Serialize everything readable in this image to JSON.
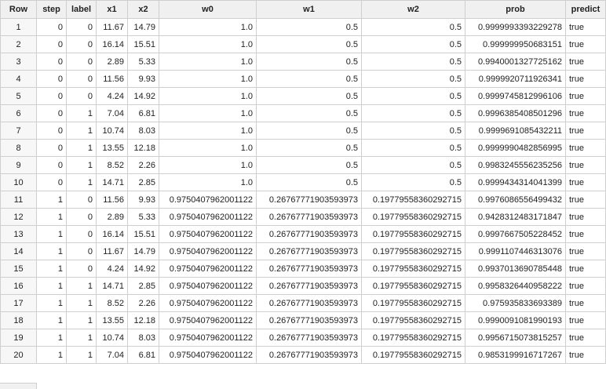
{
  "table": {
    "columns": [
      "Row",
      "step",
      "label",
      "x1",
      "x2",
      "w0",
      "w1",
      "w2",
      "prob",
      "predict"
    ],
    "rows": [
      [
        "1",
        "0",
        "0",
        "11.67",
        "14.79",
        "1.0",
        "0.5",
        "0.5",
        "0.9999993393229278",
        "true"
      ],
      [
        "2",
        "0",
        "0",
        "16.14",
        "15.51",
        "1.0",
        "0.5",
        "0.5",
        "0.999999950683151",
        "true"
      ],
      [
        "3",
        "0",
        "0",
        "2.89",
        "5.33",
        "1.0",
        "0.5",
        "0.5",
        "0.9940001327725162",
        "true"
      ],
      [
        "4",
        "0",
        "0",
        "11.56",
        "9.93",
        "1.0",
        "0.5",
        "0.5",
        "0.9999920711926341",
        "true"
      ],
      [
        "5",
        "0",
        "0",
        "4.24",
        "14.92",
        "1.0",
        "0.5",
        "0.5",
        "0.9999745812996106",
        "true"
      ],
      [
        "6",
        "0",
        "1",
        "7.04",
        "6.81",
        "1.0",
        "0.5",
        "0.5",
        "0.9996385408501296",
        "true"
      ],
      [
        "7",
        "0",
        "1",
        "10.74",
        "8.03",
        "1.0",
        "0.5",
        "0.5",
        "0.9999691085432211",
        "true"
      ],
      [
        "8",
        "0",
        "1",
        "13.55",
        "12.18",
        "1.0",
        "0.5",
        "0.5",
        "0.9999990482856995",
        "true"
      ],
      [
        "9",
        "0",
        "1",
        "8.52",
        "2.26",
        "1.0",
        "0.5",
        "0.5",
        "0.9983245556235256",
        "true"
      ],
      [
        "10",
        "0",
        "1",
        "14.71",
        "2.85",
        "1.0",
        "0.5",
        "0.5",
        "0.9999434314041399",
        "true"
      ],
      [
        "11",
        "1",
        "0",
        "11.56",
        "9.93",
        "0.9750407962001122",
        "0.26767771903593973",
        "0.19779558360292715",
        "0.9976086556499432",
        "true"
      ],
      [
        "12",
        "1",
        "0",
        "2.89",
        "5.33",
        "0.9750407962001122",
        "0.26767771903593973",
        "0.19779558360292715",
        "0.9428312483171847",
        "true"
      ],
      [
        "13",
        "1",
        "0",
        "16.14",
        "15.51",
        "0.9750407962001122",
        "0.26767771903593973",
        "0.19779558360292715",
        "0.9997667505228452",
        "true"
      ],
      [
        "14",
        "1",
        "0",
        "11.67",
        "14.79",
        "0.9750407962001122",
        "0.26767771903593973",
        "0.19779558360292715",
        "0.9991107446313076",
        "true"
      ],
      [
        "15",
        "1",
        "0",
        "4.24",
        "14.92",
        "0.9750407962001122",
        "0.26767771903593973",
        "0.19779558360292715",
        "0.9937013690785448",
        "true"
      ],
      [
        "16",
        "1",
        "1",
        "14.71",
        "2.85",
        "0.9750407962001122",
        "0.26767771903593973",
        "0.19779558360292715",
        "0.9958326440958222",
        "true"
      ],
      [
        "17",
        "1",
        "1",
        "8.52",
        "2.26",
        "0.9750407962001122",
        "0.26767771903593973",
        "0.19779558360292715",
        "0.975935833693389",
        "true"
      ],
      [
        "18",
        "1",
        "1",
        "13.55",
        "12.18",
        "0.9750407962001122",
        "0.26767771903593973",
        "0.19779558360292715",
        "0.9990091081990193",
        "true"
      ],
      [
        "19",
        "1",
        "1",
        "10.74",
        "8.03",
        "0.9750407962001122",
        "0.26767771903593973",
        "0.19779558360292715",
        "0.9956715073815257",
        "true"
      ],
      [
        "20",
        "1",
        "1",
        "7.04",
        "6.81",
        "0.9750407962001122",
        "0.26767771903593973",
        "0.19779558360292715",
        "0.9853199916717267",
        "true"
      ]
    ]
  }
}
